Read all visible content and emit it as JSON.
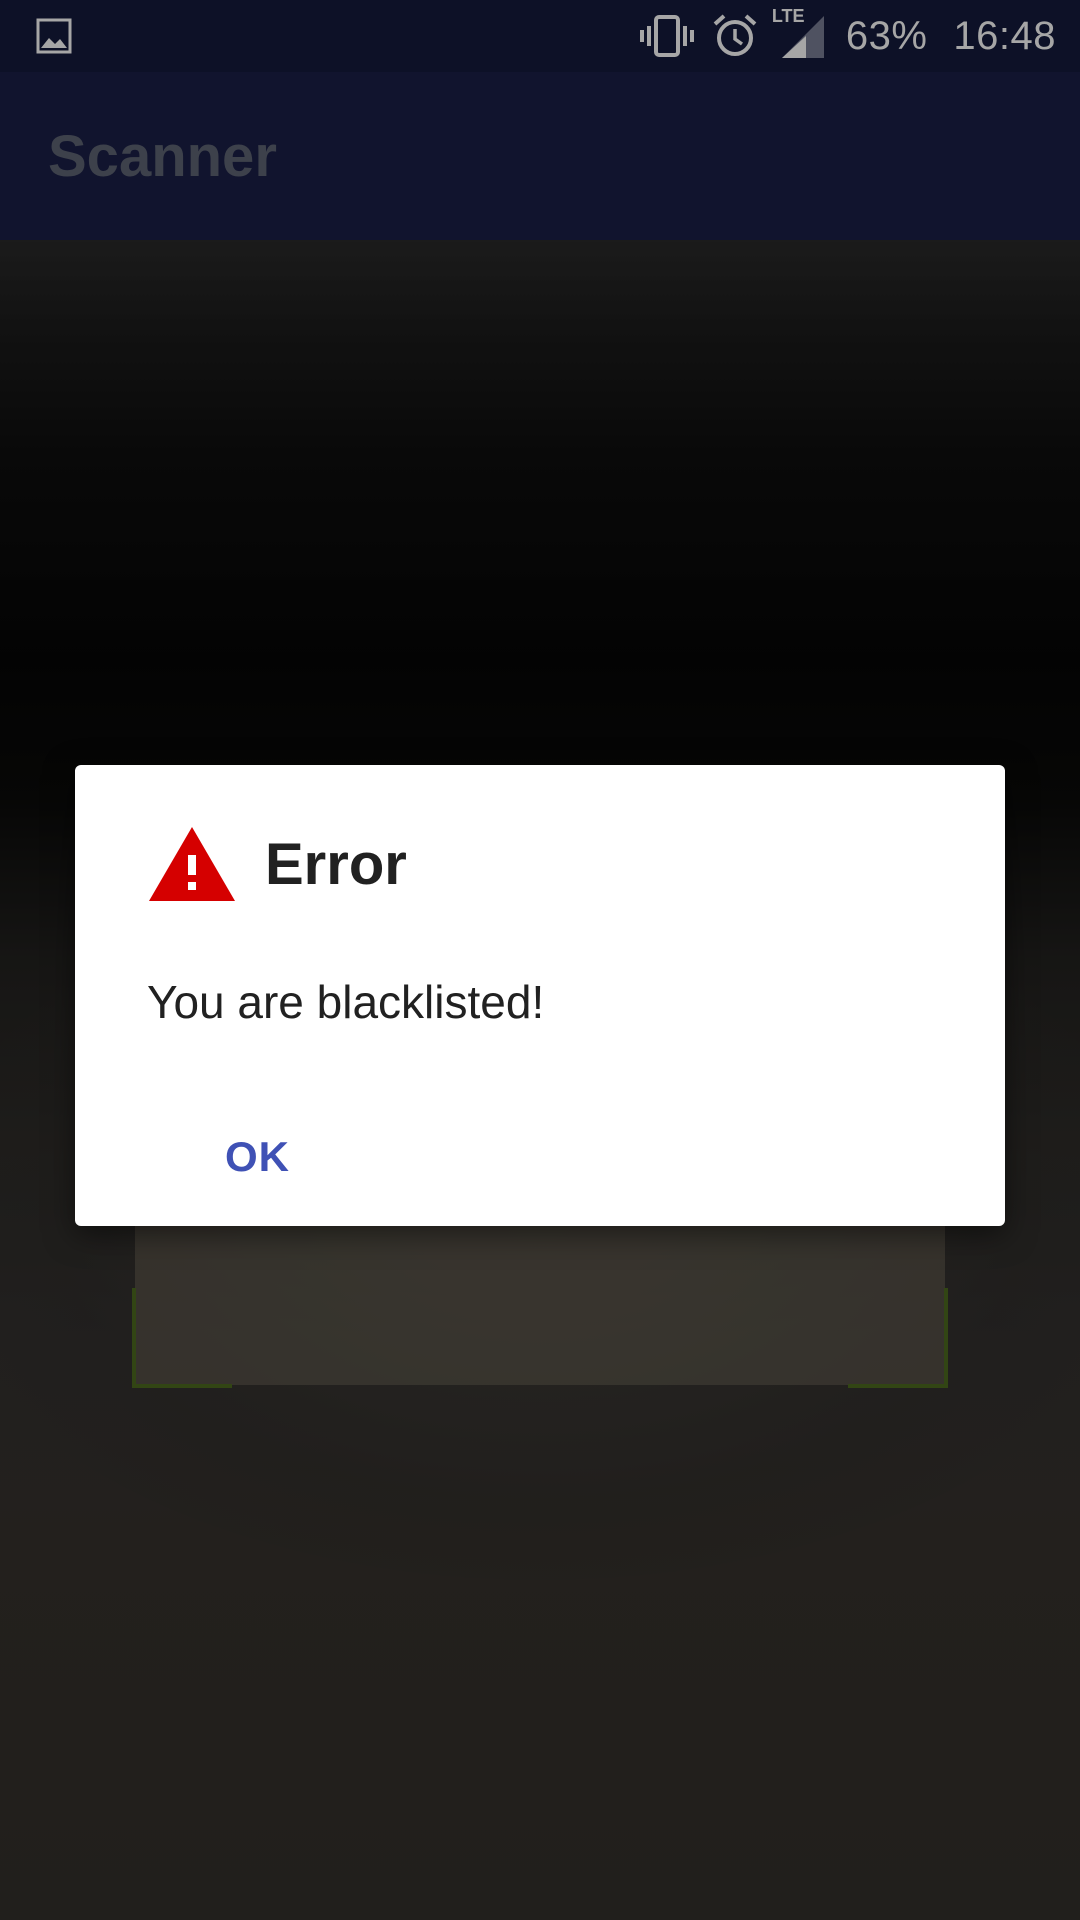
{
  "status_bar": {
    "battery": "63%",
    "time": "16:48",
    "network": "LTE",
    "icons": [
      "image-icon",
      "vibrate-icon",
      "alarm-icon",
      "signal-icon"
    ]
  },
  "app_bar": {
    "title": "Scanner"
  },
  "dialog": {
    "icon": "warning-icon",
    "title": "Error",
    "message": "You are blacklisted!",
    "ok_label": "OK"
  },
  "colors": {
    "status_bar": "#141b3c",
    "app_bar": "#1b2048",
    "app_title": "#5f6473",
    "accent": "#3f51b5",
    "warning": "#d50000",
    "scan_corner": "#4e6b1f"
  }
}
